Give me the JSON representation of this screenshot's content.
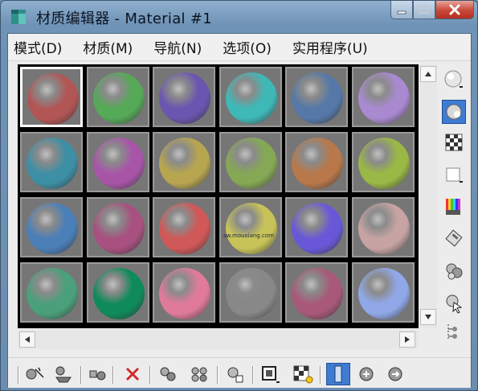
{
  "window": {
    "title": "材质编辑器 - Material #1"
  },
  "menu": {
    "items": [
      "模式(D)",
      "材质(M)",
      "导航(N)",
      "选项(O)",
      "实用程序(U)"
    ]
  },
  "slots": {
    "selected_index": 0,
    "colors": [
      "#b25555",
      "#55a957",
      "#6a55b0",
      "#3fb8b8",
      "#5578a8",
      "#a98ad0",
      "#3d8fa5",
      "#a855a8",
      "#b8a550",
      "#85a855",
      "#b8784a",
      "#9ab845",
      "#4a7fb8",
      "#a8507f",
      "#d05858",
      "#c8c358",
      "#6858d8",
      "#c8a3a3",
      "#4aa07a",
      "#0f8a5a",
      "#e07a9a",
      "#888888",
      "#a85878",
      "#90a8e8"
    ]
  },
  "watermark": "sw.mouxiang.com",
  "icons": {
    "sidebar": [
      "sample-type-icon",
      "backlight-icon",
      "background-checker-icon",
      "uv-tiling-icon",
      "video-color-check-icon",
      "make-preview-icon",
      "options-icon",
      "select-by-material-icon",
      "material-map-navigator-icon"
    ],
    "toolbar": [
      "get-material-icon",
      "put-to-scene-icon",
      "assign-to-selection-icon",
      "reset-map-icon",
      "make-unique-icon",
      "put-to-library-icon",
      "material-effects-channel-icon",
      "show-map-icon",
      "show-end-result-icon",
      "go-to-parent-icon",
      "go-forward-to-sibling-icon"
    ]
  }
}
